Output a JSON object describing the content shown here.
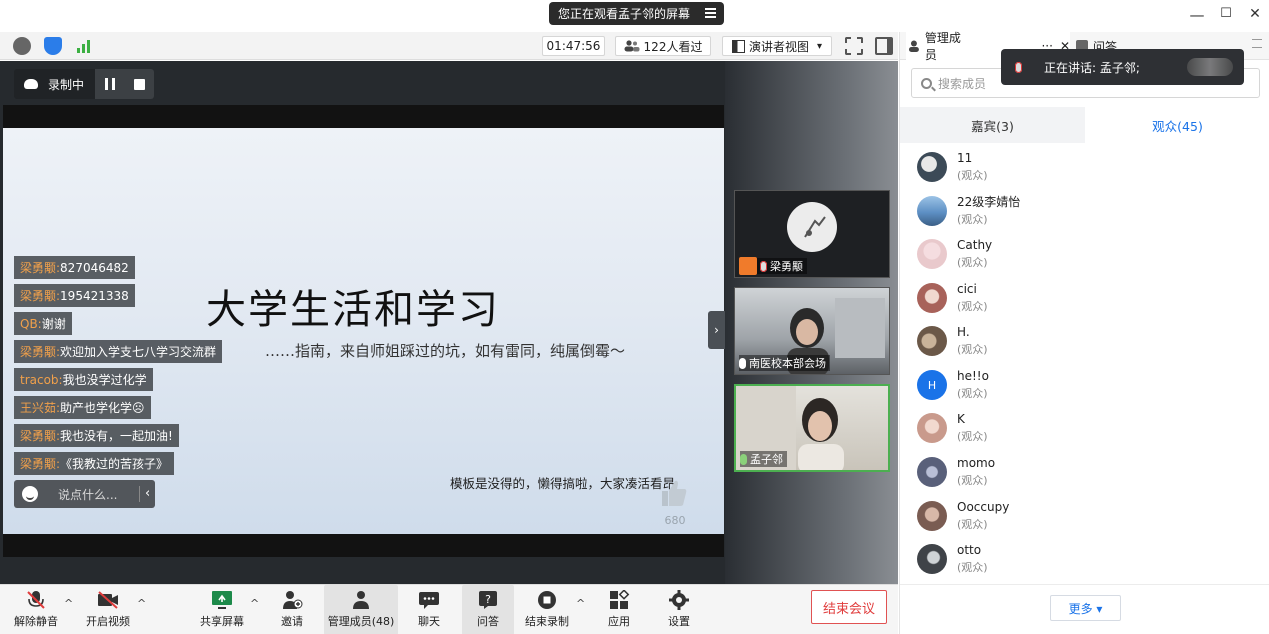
{
  "titlebar": {
    "watching_text": "您正在观看孟子邻的屏幕",
    "minimize": "—",
    "maximize": "☐",
    "close": "✕"
  },
  "toolbar": {
    "timer": "01:47:56",
    "viewers": "122人看过",
    "view_mode": "演讲者视图",
    "view_mode_caret": "▾"
  },
  "recording": {
    "label": "录制中"
  },
  "slide": {
    "title": "大学生活和学习",
    "subtitle": "……指南，来自师姐踩过的坑，如有雷同，纯属倒霉～",
    "note": "模板是没得的，懒得搞啦，大家凑活看昂",
    "likes": "680"
  },
  "chat": {
    "messages": [
      {
        "name": "梁勇颙:",
        "text": " 827046482"
      },
      {
        "name": "梁勇颙:",
        "text": " 195421338"
      },
      {
        "name": "QB:",
        "text": " 谢谢"
      },
      {
        "name": "梁勇颙:",
        "text": " 欢迎加入学支七八学习交流群"
      },
      {
        "name": "tracob:",
        "text": " 我也没学过化学"
      },
      {
        "name": "王兴茹:",
        "text": " 助产也学化学☹"
      },
      {
        "name": "梁勇颙:",
        "text": " 我也没有，一起加油!"
      },
      {
        "name": "梁勇颙:",
        "text": " 《我教过的苦孩子》"
      }
    ],
    "input_placeholder": "说点什么...",
    "collapse_chevron": "‹"
  },
  "video_tiles": [
    {
      "name": "梁勇颙"
    },
    {
      "name": "南医校本部会场"
    },
    {
      "name": "孟子邻"
    }
  ],
  "collapse_strip": "›",
  "right_panel": {
    "tab_members": "管理成员",
    "tab_more": "···",
    "tab_close": "✕",
    "tab_qa": "问答",
    "speaking_text": "正在讲话: 孟子邻;",
    "search_placeholder": "搜索成员",
    "seg_guests": "嘉宾(3)",
    "seg_audience": "观众(45)",
    "members": [
      {
        "name": "11",
        "role": "(观众)",
        "color": "#3c4a57"
      },
      {
        "name": "22级李婧怡",
        "role": "(观众)",
        "color": "#5d8fc4"
      },
      {
        "name": "Cathy",
        "role": "(观众)",
        "color": "#e9c9cc"
      },
      {
        "name": "cici",
        "role": "(观众)",
        "color": "#a8625a"
      },
      {
        "name": "H.",
        "role": "(观众)",
        "color": "#6b5848"
      },
      {
        "name": "he!!o",
        "role": "(观众)",
        "color": "#1a73e8",
        "initial": "H"
      },
      {
        "name": "K",
        "role": "(观众)",
        "color": "#c99a8c"
      },
      {
        "name": "momo",
        "role": "(观众)",
        "color": "#59607a"
      },
      {
        "name": "Ooccupy",
        "role": "(观众)",
        "color": "#7a5c52"
      },
      {
        "name": "otto",
        "role": "(观众)",
        "color": "#3f4348"
      }
    ],
    "more_button": "更多 ▾"
  },
  "bottombar": {
    "unmute": "解除静音",
    "start_video": "开启视频",
    "share_screen": "共享屏幕",
    "invite": "邀请",
    "manage_members": "管理成员(48)",
    "chat": "聊天",
    "qa": "问答",
    "end_recording": "结束录制",
    "apps": "应用",
    "settings": "设置",
    "end_meeting": "结束会议",
    "caret": "^"
  },
  "colors": {
    "accent_blue": "#1a73e8",
    "end_red": "#e03c3c",
    "chat_name_orange": "#f0a04b"
  }
}
